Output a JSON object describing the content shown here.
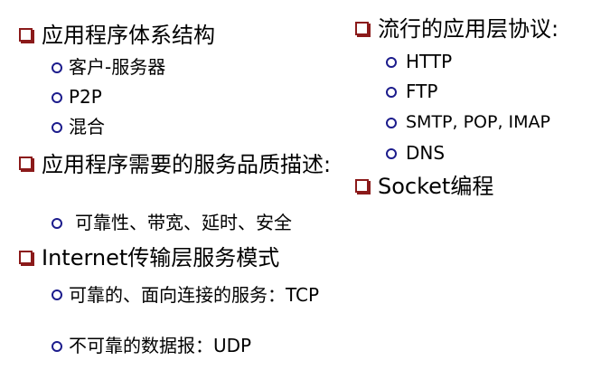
{
  "colors": {
    "square_bullet": "#8b1a1a",
    "circle_bullet": "#1c1c8c",
    "text": "#000000",
    "background": "#ffffff"
  },
  "left": {
    "s1": {
      "title": "应用程序体系结构",
      "items": [
        "客户-服务器",
        "P2P",
        "混合"
      ]
    },
    "s2": {
      "title": "应用程序需要的服务品质描述:",
      "items": [
        "可靠性、带宽、延时、安全"
      ]
    },
    "s3": {
      "title": "Internet传输层服务模式",
      "items": [
        "可靠的、面向连接的服务：TCP",
        "不可靠的数据报：UDP"
      ]
    }
  },
  "right": {
    "s1": {
      "title": "流行的应用层协议:",
      "items": [
        "HTTP",
        "FTP",
        "SMTP, POP, IMAP",
        "DNS"
      ]
    },
    "s2": {
      "title": "Socket编程"
    }
  }
}
